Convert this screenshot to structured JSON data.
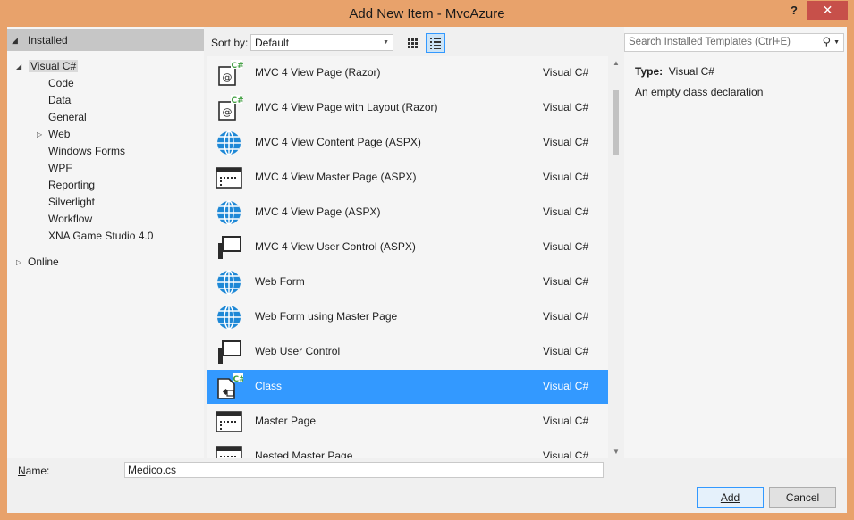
{
  "window": {
    "title": "Add New Item - MvcAzure",
    "help": "?",
    "close": "✕"
  },
  "left": {
    "installed_label": "Installed",
    "tree": [
      {
        "label": "Visual C#",
        "arrow": "◢",
        "level": 0
      },
      {
        "label": "Code",
        "level": 1
      },
      {
        "label": "Data",
        "level": 1
      },
      {
        "label": "General",
        "level": 1
      },
      {
        "label": "Web",
        "arrow": "▷",
        "level": 1
      },
      {
        "label": "Windows Forms",
        "level": 1
      },
      {
        "label": "WPF",
        "level": 1
      },
      {
        "label": "Reporting",
        "level": 1
      },
      {
        "label": "Silverlight",
        "level": 1
      },
      {
        "label": "Workflow",
        "level": 1
      },
      {
        "label": "XNA Game Studio 4.0",
        "level": 1
      }
    ],
    "online_label": "Online",
    "online_arrow": "▷"
  },
  "sort": {
    "label": "Sort by:",
    "value": "Default"
  },
  "templates": [
    {
      "name": "MVC 4 View Page (Razor)",
      "lang": "Visual C#",
      "icon": "razor-page-icon"
    },
    {
      "name": "MVC 4 View Page with Layout (Razor)",
      "lang": "Visual C#",
      "icon": "razor-page-icon"
    },
    {
      "name": "MVC 4 View Content Page (ASPX)",
      "lang": "Visual C#",
      "icon": "globe-icon"
    },
    {
      "name": "MVC 4 View Master Page (ASPX)",
      "lang": "Visual C#",
      "icon": "master-page-icon"
    },
    {
      "name": "MVC 4 View Page (ASPX)",
      "lang": "Visual C#",
      "icon": "globe-icon"
    },
    {
      "name": "MVC 4 View User Control (ASPX)",
      "lang": "Visual C#",
      "icon": "user-control-icon"
    },
    {
      "name": "Web Form",
      "lang": "Visual C#",
      "icon": "globe-icon"
    },
    {
      "name": "Web Form using Master Page",
      "lang": "Visual C#",
      "icon": "globe-icon"
    },
    {
      "name": "Web User Control",
      "lang": "Visual C#",
      "icon": "user-control-icon"
    },
    {
      "name": "Class",
      "lang": "Visual C#",
      "icon": "class-icon"
    },
    {
      "name": "Master Page",
      "lang": "Visual C#",
      "icon": "master-page-icon"
    },
    {
      "name": "Nested Master Page",
      "lang": "Visual C#",
      "icon": "master-page-icon"
    }
  ],
  "selected_index": 9,
  "search": {
    "placeholder": "Search Installed Templates (Ctrl+E)"
  },
  "details": {
    "type_label": "Type:",
    "type_value": "Visual C#",
    "description": "An empty class declaration"
  },
  "bottom": {
    "name_label": "Name:",
    "name_value": "Medico.cs",
    "add_label": "Add",
    "cancel_label": "Cancel"
  },
  "colors": {
    "frame": "#e8a26b",
    "selection": "#3399ff",
    "close": "#c7504a",
    "icon_blue": "#1e88d6",
    "cs_green": "#3f9e3f"
  }
}
